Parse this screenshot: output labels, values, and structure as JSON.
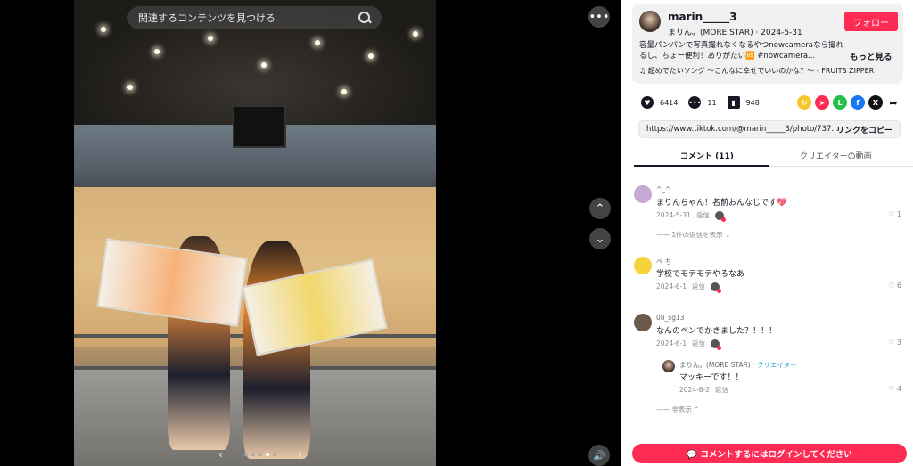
{
  "search": {
    "placeholder": "関連するコンテンツを見つける"
  },
  "viewer": {
    "more_label": "•••",
    "up_label": "⌃",
    "down_label": "⌄",
    "sound_label": "🔊",
    "prev_label": "‹",
    "next_label": "›"
  },
  "post": {
    "username": "marin_____3",
    "display_meta": "まりん。(MORE STAR) · 2024-5-31",
    "follow_label": "フォロー",
    "description": "容量パンパンで写真撮れなくなるやつnowcameraなら撮れるし、ちょー便利！ありがたい🆚 #nowcamera...",
    "more_label": "もっと見る",
    "music": "♫  超めでたいソング 〜こんなに幸せでいいのかな？〜 - FRUITS ZIPPER"
  },
  "stats": {
    "likes": "6414",
    "comments": "11",
    "saves": "948"
  },
  "link": {
    "url": "https://www.tiktok.com/@marin_____3/photo/737...",
    "copy_label": "リンクをコピー"
  },
  "tabs": {
    "comments": "コメント (11)",
    "creator_videos": "クリエイターの動画"
  },
  "comments": [
    {
      "name": "^_^",
      "text": "まりんちゃん！名前おんなじです💖",
      "date": "2024-5-31",
      "reply": "返信",
      "likes": "1",
      "thread": "—— 1件の返信を表示  ⌄"
    },
    {
      "name": "ぺ ち",
      "text": "学校でモテモテやろなあ",
      "date": "2024-6-1",
      "reply": "返信",
      "likes": "6"
    },
    {
      "name": "08_sg13",
      "text": "なんのペンでかきました？！！！",
      "date": "2024-6-1",
      "reply": "返信",
      "likes": "3"
    }
  ],
  "reply": {
    "name": "まりん。(MORE STAR) · ",
    "creator_tag": "クリエイター",
    "text": "マッキーです！！",
    "date": "2024-6-2",
    "reply": "返信",
    "likes": "4",
    "hide": "—— 非表示  ⌃"
  },
  "login": {
    "label": "💬 コメントするにはログインしてください"
  },
  "colors": {
    "accent": "#fe2c55",
    "creator": "#2aa1d8"
  }
}
